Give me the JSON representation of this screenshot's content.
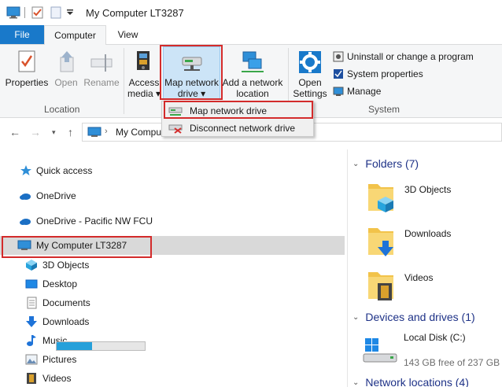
{
  "window": {
    "title": "My Computer LT3287"
  },
  "ribbon_tabs": {
    "file": "File",
    "computer": "Computer",
    "view": "View"
  },
  "ribbon": {
    "properties": "Properties",
    "open": "Open",
    "rename": "Rename",
    "location_group": "Location",
    "access_media_1": "Access",
    "access_media_2": "media ▾",
    "map_network_drive_1": "Map network",
    "map_network_drive_2": "drive ▾",
    "add_network_location_1": "Add a network",
    "add_network_location_2": "location",
    "open_settings_1": "Open",
    "open_settings_2": "Settings",
    "uninstall": "Uninstall or change a program",
    "system_properties": "System properties",
    "manage": "Manage",
    "system_group": "System"
  },
  "dropdown": {
    "map_network_drive": "Map network drive",
    "disconnect_network_drive": "Disconnect network drive"
  },
  "address": {
    "path": "My Compu"
  },
  "nav": {
    "quick_access": "Quick access",
    "onedrive": "OneDrive",
    "onedrive_pnw": "OneDrive - Pacific NW FCU",
    "my_computer": "My Computer LT3287",
    "objects3d": "3D Objects",
    "desktop": "Desktop",
    "documents": "Documents",
    "downloads": "Downloads",
    "music": "Music",
    "pictures": "Pictures",
    "videos": "Videos"
  },
  "content": {
    "folders_header": "Folders (7)",
    "folders": [
      "3D Objects",
      "Downloads",
      "Videos"
    ],
    "devices_header": "Devices and drives (1)",
    "disk_name": "Local Disk (C:)",
    "disk_free": "143 GB free of 237 GB",
    "disk_used_fraction": 0.4,
    "network_header": "Network locations (4)"
  },
  "colors": {
    "accent": "#1979ca",
    "highlight": "#d32b2b",
    "section_header": "#1e3287"
  }
}
